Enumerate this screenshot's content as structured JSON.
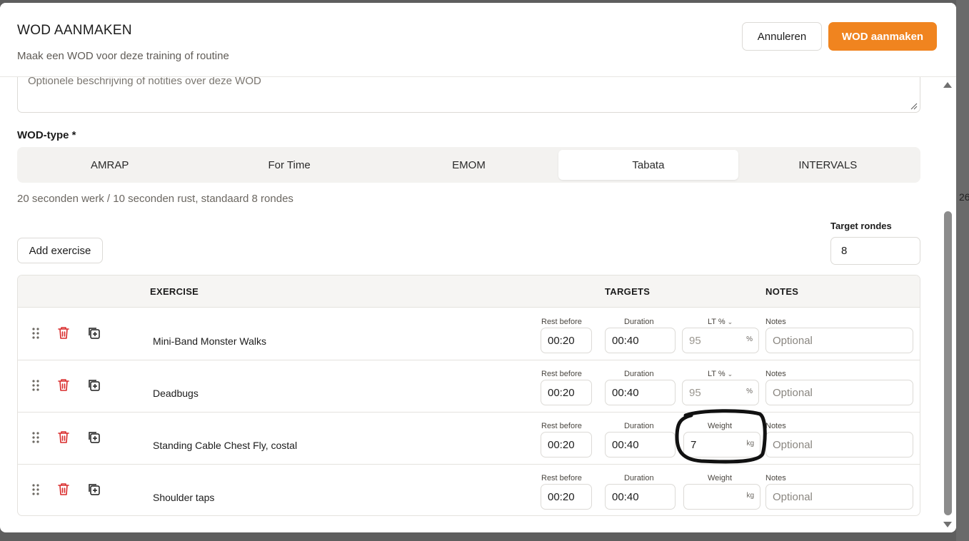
{
  "header": {
    "title": "WOD AANMAKEN",
    "subtitle": "Maak een WOD voor deze training of routine",
    "cancel_label": "Annuleren",
    "create_label": "WOD aanmaken"
  },
  "description": {
    "placeholder": "Optionele beschrijving of notities over deze WOD"
  },
  "wod_type": {
    "label": "WOD-type *",
    "tabs": [
      "AMRAP",
      "For Time",
      "EMOM",
      "Tabata",
      "INTERVALS"
    ],
    "selected": "Tabata",
    "hint": "20 seconden werk / 10 seconden rust, standaard 8 rondes"
  },
  "add_exercise_label": "Add exercise",
  "target_rounds": {
    "label": "Target rondes",
    "value": "8"
  },
  "table": {
    "headers": {
      "exercise": "EXERCISE",
      "targets": "TARGETS",
      "notes": "NOTES"
    },
    "field_labels": {
      "rest": "Rest before",
      "duration": "Duration",
      "lt": "LT %",
      "weight": "Weight",
      "notes": "Notes",
      "pct_unit": "%",
      "kg_unit": "kg",
      "notes_placeholder": "Optional"
    },
    "rows": [
      {
        "name": "Mini-Band Monster Walks",
        "rest": "00:20",
        "duration": "00:40",
        "third_label": "LT %",
        "third_value": "95",
        "third_unit": "%"
      },
      {
        "name": "Deadbugs",
        "rest": "00:20",
        "duration": "00:40",
        "third_label": "LT %",
        "third_value": "95",
        "third_unit": "%"
      },
      {
        "name": "Standing Cable Chest Fly, costal",
        "rest": "00:20",
        "duration": "00:40",
        "third_label": "Weight",
        "third_value": "7",
        "third_unit": "kg"
      },
      {
        "name": "Shoulder taps",
        "rest": "00:20",
        "duration": "00:40",
        "third_label": "Weight",
        "third_value": "",
        "third_unit": "kg"
      }
    ]
  },
  "background_fragments": [
    "26"
  ],
  "colors": {
    "accent": "#f0841f",
    "trash": "#d92b2b"
  }
}
